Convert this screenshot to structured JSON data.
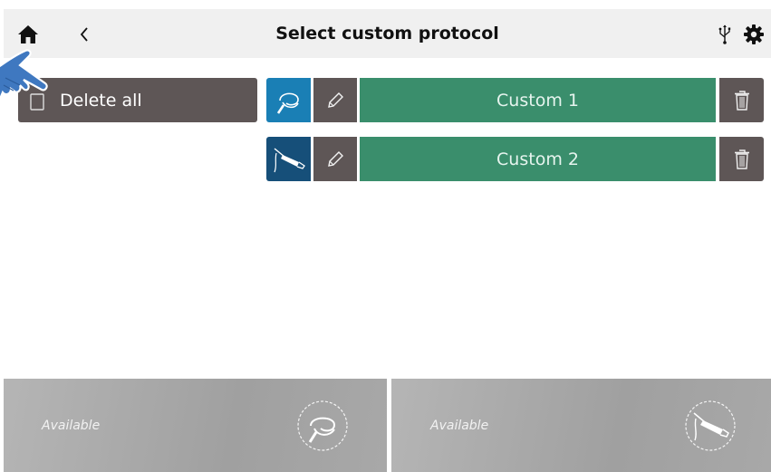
{
  "header": {
    "title": "Select custom protocol",
    "icons": [
      "home-icon",
      "back-icon",
      "usb-icon",
      "gear-icon"
    ]
  },
  "delete_all": {
    "label": "Delete all"
  },
  "protocols": [
    {
      "name": "Custom 1",
      "icon": "headset-applicator-icon",
      "icon_bg": "#1a7fb5"
    },
    {
      "name": "Custom 2",
      "icon": "handpiece-applicator-icon",
      "icon_bg": "#164f79"
    }
  ],
  "slots": [
    {
      "status": "Available",
      "icon": "headset-applicator-icon"
    },
    {
      "status": "Available",
      "icon": "handpiece-applicator-icon"
    }
  ],
  "colors": {
    "accent_green": "#3a8e6c",
    "button_dark": "#5e5656",
    "header_bg": "#f0f0f0"
  }
}
